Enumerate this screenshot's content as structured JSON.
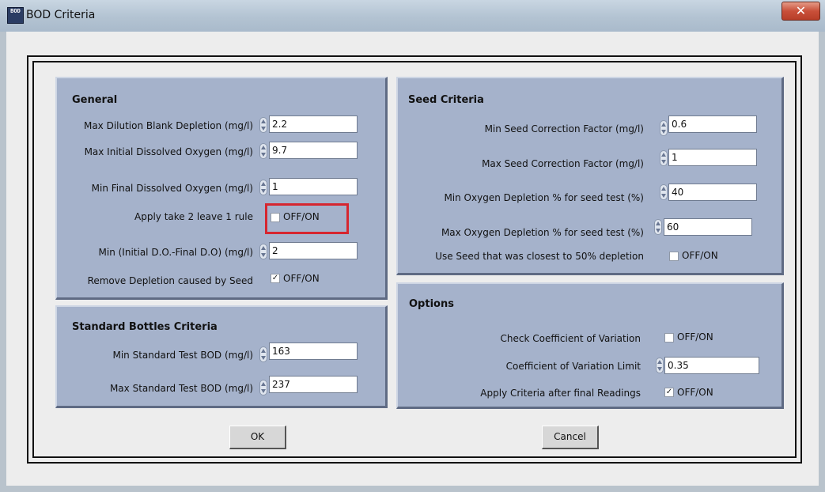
{
  "window": {
    "title": "BOD Criteria",
    "icon_text": "BOD",
    "close_symbol": "✕"
  },
  "general": {
    "title": "General",
    "max_dilution_blank_depletion": {
      "label": "Max Dilution Blank Depletion (mg/l)",
      "value": "2.2"
    },
    "max_initial_do": {
      "label": "Max Initial Dissolved Oxygen (mg/l)",
      "value": "9.7"
    },
    "min_final_do": {
      "label": "Min Final Dissolved Oxygen (mg/l)",
      "value": "1"
    },
    "take2leave1": {
      "label": "Apply take 2 leave 1 rule",
      "toggle_label": "OFF/ON",
      "checked": false
    },
    "min_initial_minus_final": {
      "label": "Min (Initial D.O.-Final D.O) (mg/l)",
      "value": "2"
    },
    "remove_seed_depletion": {
      "label": "Remove Depletion caused by Seed",
      "toggle_label": "OFF/ON",
      "checked": true
    }
  },
  "standard": {
    "title": "Standard Bottles Criteria",
    "min_test_bod": {
      "label": "Min Standard Test BOD (mg/l)",
      "value": "163"
    },
    "max_test_bod": {
      "label": "Max Standard Test BOD (mg/l)",
      "value": "237"
    }
  },
  "seed": {
    "title": "Seed Criteria",
    "min_correction": {
      "label": "Min Seed Correction Factor (mg/l)",
      "value": "0.6"
    },
    "max_correction": {
      "label": "Max Seed Correction Factor (mg/l)",
      "value": "1"
    },
    "min_o2_depletion": {
      "label": "Min Oxygen Depletion % for seed test (%)",
      "value": "40"
    },
    "max_o2_depletion": {
      "label": "Max Oxygen Depletion % for seed test (%)",
      "value": "60"
    },
    "closest_50": {
      "label": "Use Seed that was closest to 50% depletion",
      "toggle_label": "OFF/ON",
      "checked": false
    }
  },
  "options": {
    "title": "Options",
    "check_cov": {
      "label": "Check Coefficient of Variation",
      "toggle_label": "OFF/ON",
      "checked": false
    },
    "cov_limit": {
      "label": "Coefficient of Variation Limit",
      "value": "0.35"
    },
    "after_final": {
      "label": "Apply Criteria after final Readings",
      "toggle_label": "OFF/ON",
      "checked": true
    }
  },
  "buttons": {
    "ok": "OK",
    "cancel": "Cancel"
  },
  "marks": {
    "checked": "✓",
    "unchecked": ""
  },
  "colors": {
    "panel": "#a5b2cb",
    "highlight": "#d6262f",
    "titlebar": "#b3c3d2",
    "client": "#ededed"
  }
}
